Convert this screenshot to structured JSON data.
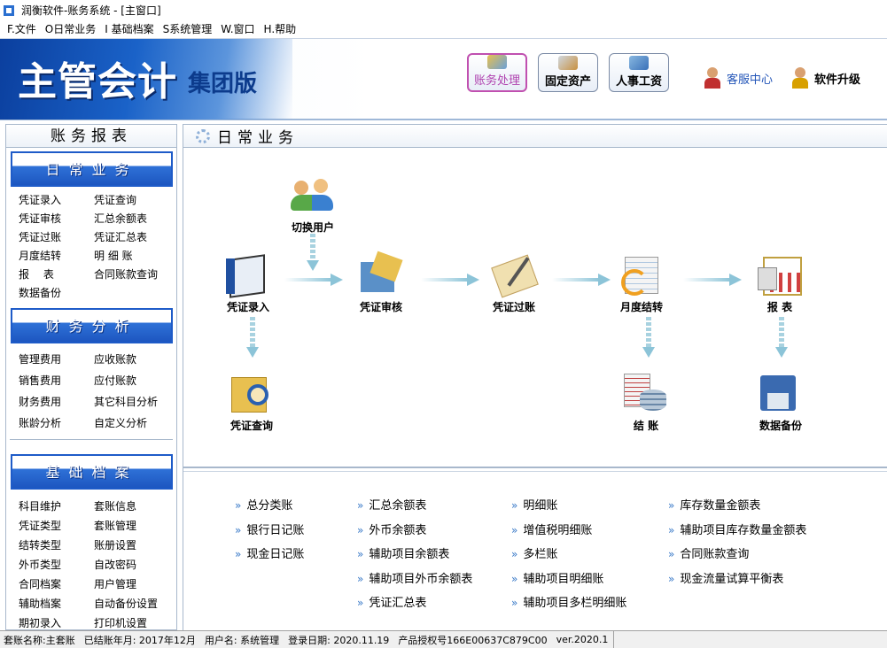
{
  "window": {
    "title": "润衡软件-账务系统 - [主窗口]"
  },
  "menu": [
    "F.文件",
    "O日常业务",
    "I 基础档案",
    "S系统管理",
    "W.窗口",
    "H.帮助"
  ],
  "banner": {
    "logo_main": "主管会计",
    "logo_sub": "集团版",
    "modules": [
      {
        "label": "账务处理",
        "color": "#b044b0"
      },
      {
        "label": "固定资产"
      },
      {
        "label": "人事工资"
      }
    ],
    "service_center": "客服中心",
    "upgrade": "软件升级"
  },
  "left_panel": {
    "title": "账务报表",
    "sections": [
      {
        "title": "日常业务",
        "links": [
          "凭证录入",
          "凭证查询",
          "凭证审核",
          "汇总余额表",
          "凭证过账",
          "凭证汇总表",
          "月度结转",
          "明 细 账",
          "报　 表",
          "合同账款查询",
          "数据备份"
        ]
      },
      {
        "title": "财务分析",
        "links": [
          "管理费用",
          "应收账款",
          "销售费用",
          "应付账款",
          "财务费用",
          "其它科目分析",
          "账龄分析",
          "自定义分析"
        ]
      },
      {
        "title": "基础档案",
        "links": [
          "科目维护",
          "套账信息",
          "凭证类型",
          "套账管理",
          "结转类型",
          "账册设置",
          "外币类型",
          "自改密码",
          "合同档案",
          "用户管理",
          "辅助档案",
          "自动备份设置",
          "期初录入",
          "打印机设置"
        ]
      }
    ]
  },
  "right_panel": {
    "title": "日常业务",
    "flow_nodes": {
      "switch_user": "切换用户",
      "voucher_entry": "凭证录入",
      "voucher_audit": "凭证审核",
      "voucher_post": "凭证过账",
      "monthly_close": "月度结转",
      "reports": "报 表",
      "voucher_query": "凭证查询",
      "closing": "结 账",
      "data_backup": "数据备份"
    },
    "report_columns": [
      [
        "总分类账",
        "银行日记账",
        "现金日记账"
      ],
      [
        "汇总余额表",
        "外币余额表",
        "辅助项目余额表",
        "辅助项目外币余额表",
        "凭证汇总表"
      ],
      [
        "明细账",
        "增值税明细账",
        "多栏账",
        "辅助项目明细账",
        "辅助项目多栏明细账"
      ],
      [
        "库存数量金额表",
        "辅助项目库存数量金额表",
        "合同账款查询",
        "现金流量试算平衡表"
      ]
    ]
  },
  "status_bar": {
    "account_name": "套账名称:主套账",
    "closed_period": "已结账年月: 2017年12月",
    "user_name": "用户名: 系统管理",
    "login_date": "登录日期: 2020.11.19",
    "license": "产品授权号166E00637C879C00",
    "version": "ver.2020.1"
  }
}
